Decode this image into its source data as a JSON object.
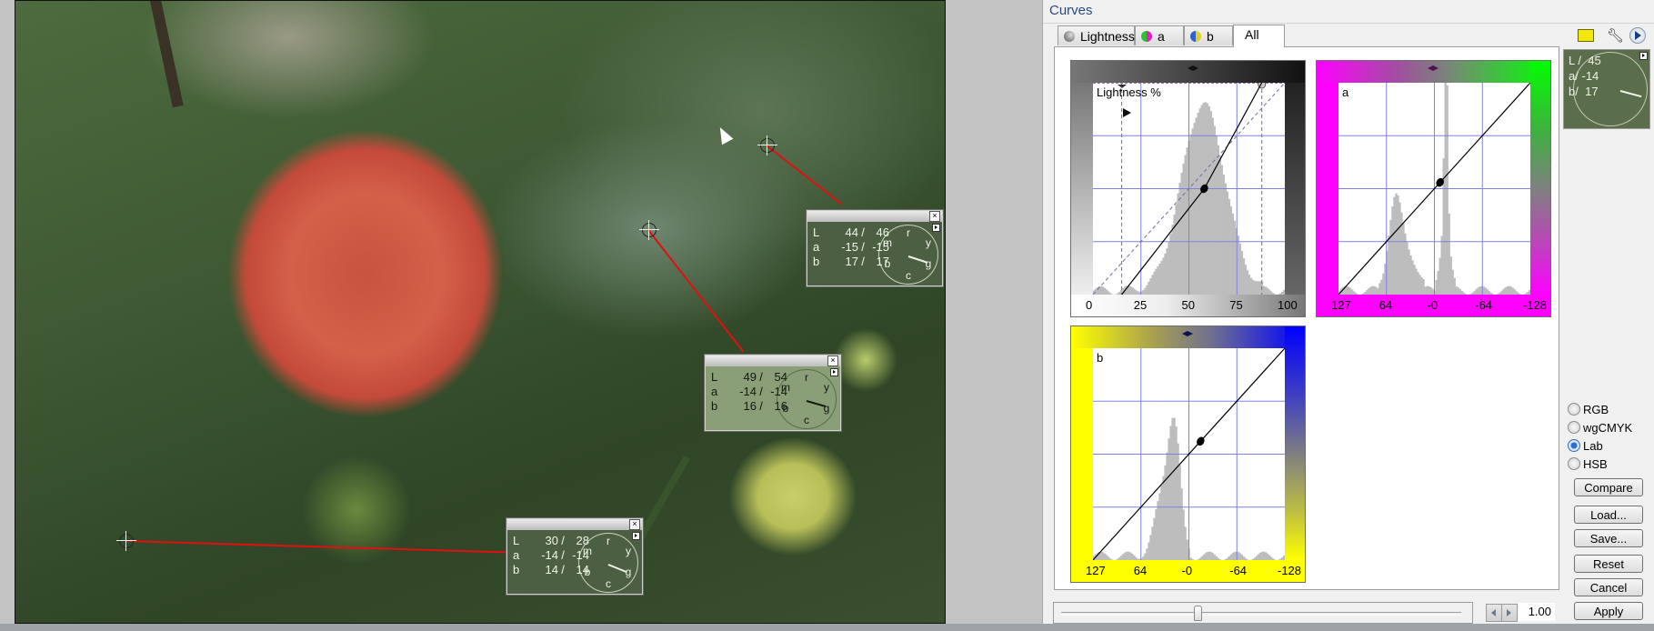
{
  "dialog": {
    "title": "Curves",
    "tabs": [
      {
        "label": "Lightness",
        "icon": "lightness-icon"
      },
      {
        "label": "a",
        "icon": "a-channel-icon"
      },
      {
        "label": "b",
        "icon": "b-channel-icon"
      },
      {
        "label": "All",
        "active": true
      }
    ],
    "panels": {
      "lightness": {
        "title": "Lightness %",
        "x_ticks": [
          "0",
          "25",
          "50",
          "75",
          "100"
        ],
        "curve_points": [
          [
            15,
            0
          ],
          [
            58,
            50
          ],
          [
            88,
            100
          ]
        ],
        "colors": {
          "frame_dark": "#111111",
          "frame_light": "#ffffff"
        }
      },
      "a": {
        "title": "a",
        "x_ticks": [
          "127",
          "64",
          "-0",
          "-64",
          "-128"
        ],
        "curve_points": [
          [
            -128,
            -128
          ],
          [
            -8,
            -8
          ],
          [
            127,
            127
          ]
        ],
        "colors": {
          "magenta": "#ff00ff",
          "green": "#00ff00"
        }
      },
      "b": {
        "title": "b",
        "x_ticks": [
          "127",
          "64",
          "-0",
          "-64",
          "-128"
        ],
        "curve_points": [
          [
            -128,
            -128
          ],
          [
            -16,
            -16
          ],
          [
            127,
            127
          ]
        ],
        "colors": {
          "yellow": "#ffff00",
          "blue": "#0000ff"
        }
      }
    },
    "readout": {
      "rows": [
        {
          "ch": "L",
          "sep": "/",
          "val": "45"
        },
        {
          "ch": "a",
          "sep": "/",
          "val": "-14"
        },
        {
          "ch": "b",
          "sep": "/",
          "val": "17"
        }
      ]
    },
    "modes": [
      {
        "label": "RGB",
        "checked": false
      },
      {
        "label": "wgCMYK",
        "checked": false
      },
      {
        "label": "Lab",
        "checked": true
      },
      {
        "label": "HSB",
        "checked": false
      }
    ],
    "buttons": {
      "compare": "Compare",
      "load": "Load...",
      "save": "Save...",
      "reset": "Reset",
      "cancel": "Cancel",
      "apply": "Apply"
    },
    "gamma_value": "1.00",
    "gamma_slider_fraction": 0.34,
    "toolbar_icons": [
      "flag-icon",
      "wrench-icon",
      "play-icon"
    ]
  },
  "probes": [
    {
      "rows": [
        [
          "L",
          "44",
          "46"
        ],
        [
          "a",
          "-15",
          "-15"
        ],
        [
          "b",
          "17",
          "17"
        ]
      ],
      "theme": "dark"
    },
    {
      "rows": [
        [
          "L",
          "49",
          "54"
        ],
        [
          "a",
          "-14",
          "-14"
        ],
        [
          "b",
          "16",
          "16"
        ]
      ],
      "theme": "light"
    },
    {
      "rows": [
        [
          "L",
          "30",
          "28"
        ],
        [
          "a",
          "-14",
          "-14"
        ],
        [
          "b",
          "14",
          "14"
        ]
      ],
      "theme": "dark"
    }
  ],
  "wheel_labels": [
    "r",
    "y",
    "g",
    "c",
    "b",
    "m"
  ]
}
